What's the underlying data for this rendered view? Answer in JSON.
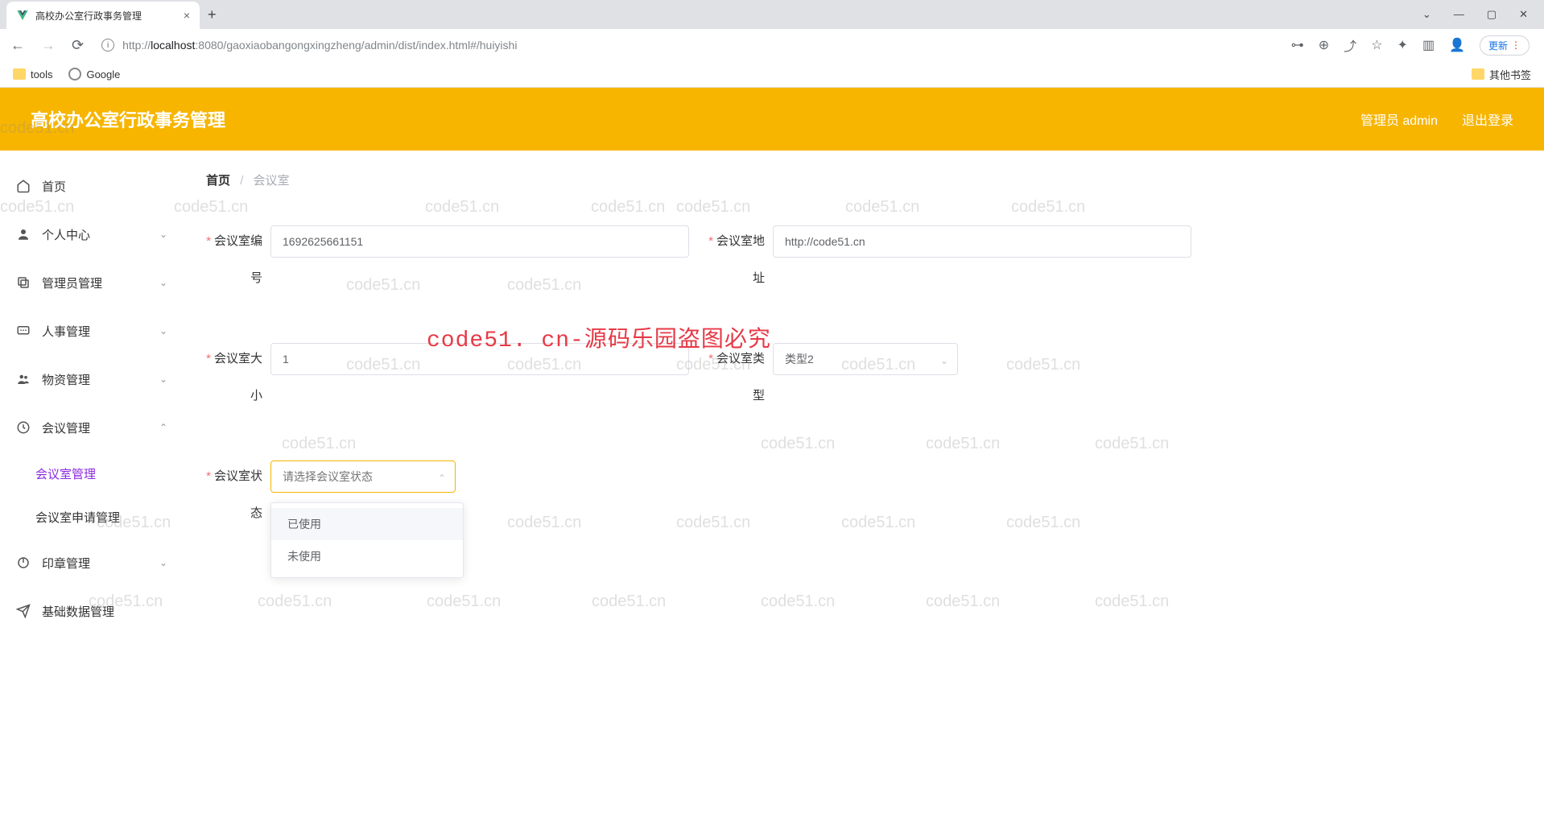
{
  "browser": {
    "tab_title": "高校办公室行政事务管理",
    "url_prefix": "http://",
    "url_host": "localhost",
    "url_path": ":8080/gaoxiaobangongxingzheng/admin/dist/index.html#/huiyishi",
    "bookmarks": {
      "tools": "tools",
      "google": "Google",
      "other": "其他书签"
    },
    "update": "更新"
  },
  "header": {
    "title": "高校办公室行政事务管理",
    "user_label": "管理员 admin",
    "logout": "退出登录"
  },
  "sidebar": {
    "home": "首页",
    "personal": "个人中心",
    "admin_mgmt": "管理员管理",
    "hr_mgmt": "人事管理",
    "material_mgmt": "物资管理",
    "meeting_mgmt": "会议管理",
    "meeting_room": "会议室管理",
    "meeting_apply": "会议室申请管理",
    "seal_mgmt": "印章管理",
    "basedata_mgmt": "基础数据管理"
  },
  "breadcrumb": {
    "home": "首页",
    "current": "会议室"
  },
  "form": {
    "room_no_label1": "会议室编",
    "room_no_label2": "号",
    "room_no_value": "1692625661151",
    "room_addr_label1": "会议室地",
    "room_addr_label2": "址",
    "room_addr_value": "http://code51.cn",
    "room_size_label1": "会议室大",
    "room_size_label2": "小",
    "room_size_value": "1",
    "room_type_label1": "会议室类",
    "room_type_label2": "型",
    "room_type_value": "类型2",
    "room_status_label1": "会议室状",
    "room_status_label2": "态",
    "room_status_placeholder": "请选择会议室状态",
    "status_options": [
      "已使用",
      "未使用"
    ]
  },
  "watermark_center": "code51. cn-源码乐园盗图必究",
  "watermark_text": "code51.cn"
}
